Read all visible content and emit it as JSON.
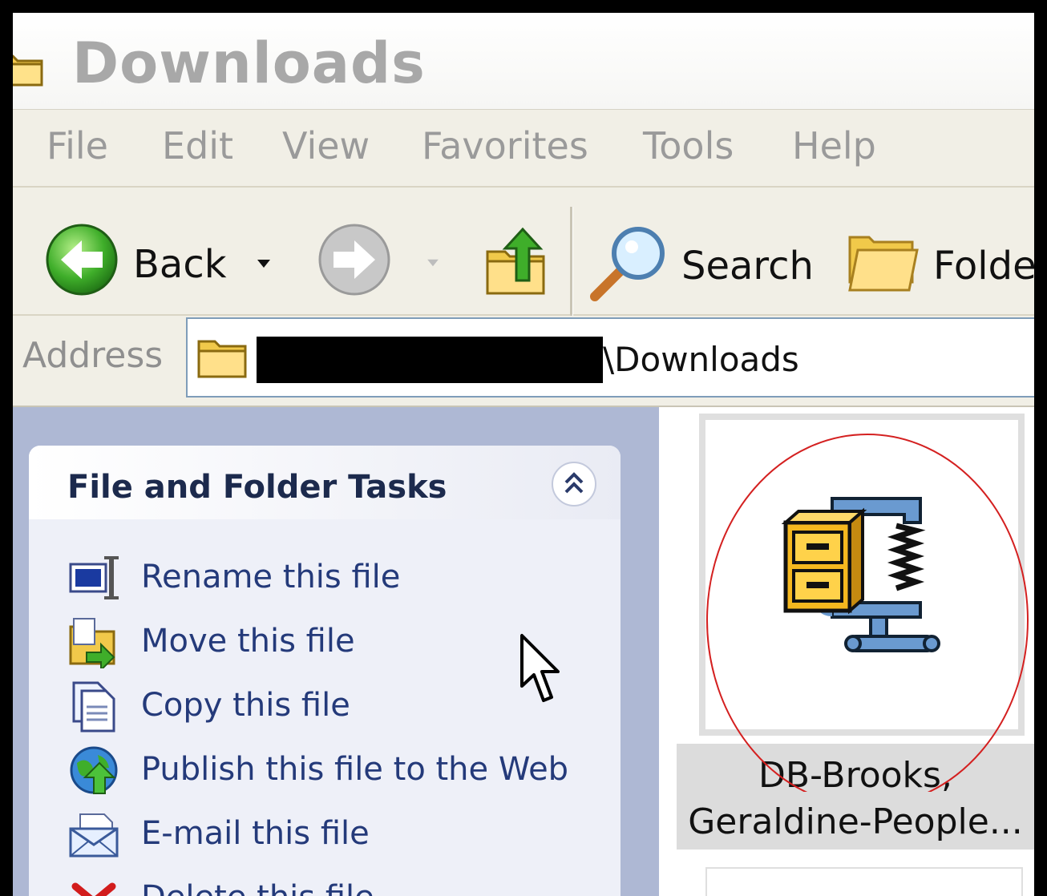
{
  "window": {
    "title": "Downloads"
  },
  "menu": {
    "items": [
      "File",
      "Edit",
      "View",
      "Favorites",
      "Tools",
      "Help"
    ]
  },
  "toolbar": {
    "back_label": "Back",
    "search_label": "Search",
    "folders_label": "Folde"
  },
  "address": {
    "label": "Address",
    "path_visible": "\\Downloads"
  },
  "task_pane": {
    "title": "File and Folder Tasks",
    "tasks": [
      {
        "label": "Rename this file",
        "icon": "rename-icon"
      },
      {
        "label": "Move this file",
        "icon": "move-icon"
      },
      {
        "label": "Copy this file",
        "icon": "copy-icon"
      },
      {
        "label": "Publish this file to the Web",
        "icon": "publish-web-icon"
      },
      {
        "label": "E-mail this file",
        "icon": "email-icon"
      },
      {
        "label": "Delete this file",
        "icon": "delete-icon"
      }
    ]
  },
  "file": {
    "name_line1": "DB-Brooks,",
    "name_line2": "Geraldine-People...",
    "icon": "winzip-archive-icon"
  },
  "colors": {
    "annotation_circle": "#d42020",
    "task_link": "#243a7a",
    "address_border": "#7f9db9"
  }
}
